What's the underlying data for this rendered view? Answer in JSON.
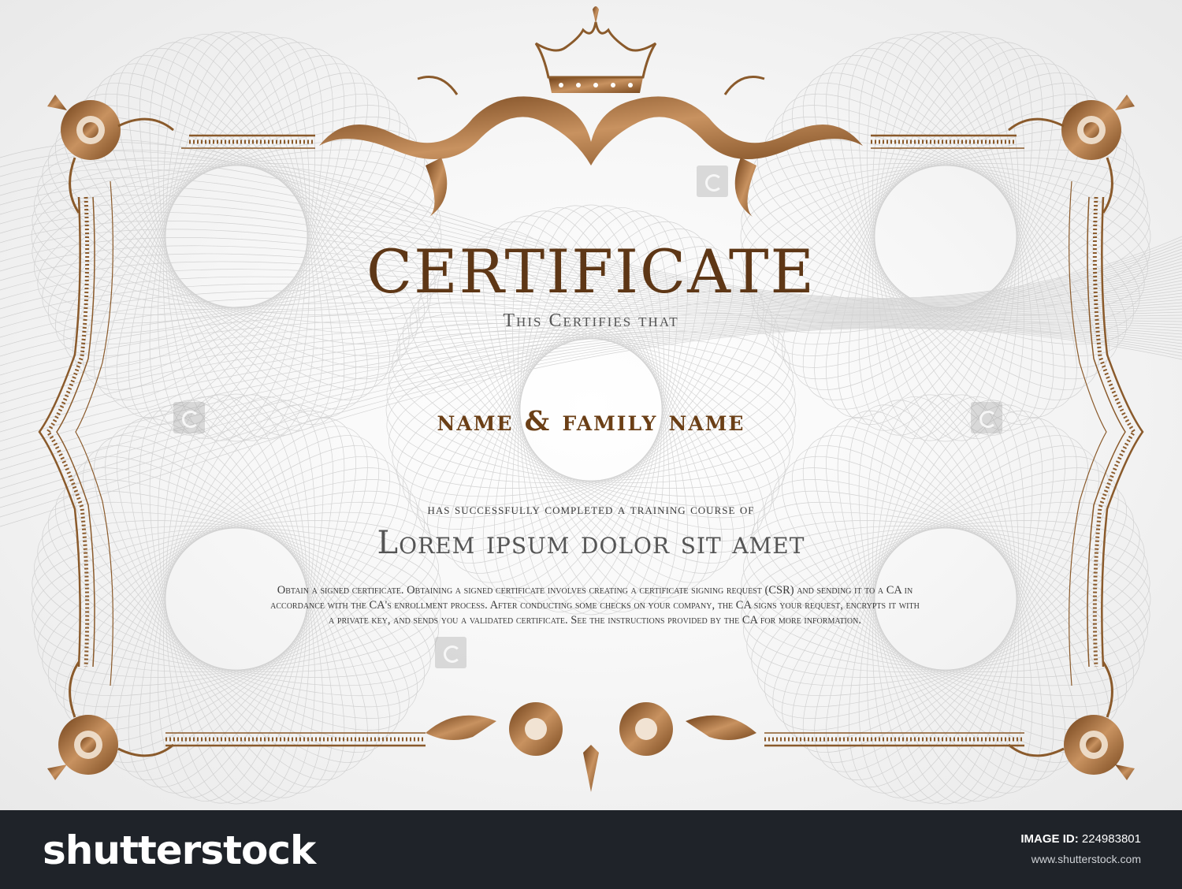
{
  "certificate": {
    "title": "CERTIFICATE",
    "subtitle": "This  Certifies that",
    "name_placeholder": "name & family name",
    "completed_text": "has successfully completed a training course of",
    "course_title": "Lorem ipsum dolor sit amet",
    "body_text": "Obtain a signed certificate. Obtaining a signed certificate involves creating a certificate signing request (CSR) and sending it to a CA in accordance with the CA's enrollment process. After conducting some checks on your company, the CA signs your request, encrypts it with a private key, and sends you a validated certificate. See the instructions provided by the CA for more information."
  },
  "footer": {
    "logo": "shutterstock",
    "image_id_label": "IMAGE ID:",
    "image_id": "224983801",
    "site": "www.shutterstock.com"
  },
  "colors": {
    "bronze": "#8a5a2b",
    "bronze_light": "#c08a55",
    "title": "#5e3716",
    "footer_bg": "#1f2329"
  },
  "icons": [
    "crown-icon",
    "scroll-ornament-icon",
    "corner-flourish-icon"
  ]
}
